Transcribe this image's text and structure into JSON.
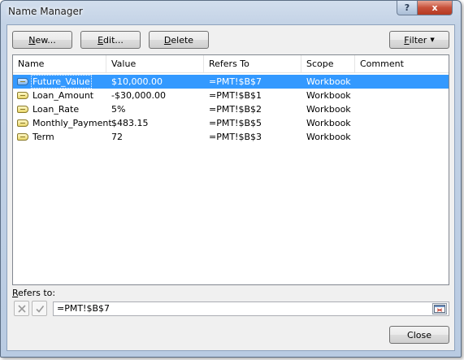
{
  "window": {
    "title": "Name Manager"
  },
  "caption": {
    "help": "?",
    "close": "x"
  },
  "toolbar": {
    "new_label_u": "N",
    "new_label_rest": "ew...",
    "edit_label_u": "E",
    "edit_label_rest": "dit...",
    "delete_label_u": "D",
    "delete_label_rest": "elete",
    "filter_label_u": "F",
    "filter_label_rest": "ilter"
  },
  "table": {
    "columns": [
      "Name",
      "Value",
      "Refers To",
      "Scope",
      "Comment"
    ],
    "rows": [
      {
        "name": "Future_Value",
        "value": "$10,000.00",
        "refers_to": "=PMT!$B$7",
        "scope": "Workbook",
        "comment": "",
        "selected": true
      },
      {
        "name": "Loan_Amount",
        "value": "-$30,000.00",
        "refers_to": "=PMT!$B$1",
        "scope": "Workbook",
        "comment": ""
      },
      {
        "name": "Loan_Rate",
        "value": "5%",
        "refers_to": "=PMT!$B$2",
        "scope": "Workbook",
        "comment": ""
      },
      {
        "name": "Monthly_Payment",
        "value": "$483.15",
        "refers_to": "=PMT!$B$5",
        "scope": "Workbook",
        "comment": ""
      },
      {
        "name": "Term",
        "value": "72",
        "refers_to": "=PMT!$B$3",
        "scope": "Workbook",
        "comment": ""
      }
    ]
  },
  "refers_to": {
    "label_u": "R",
    "label_rest": "efers to:",
    "value": "=PMT!$B$7"
  },
  "footer": {
    "close_label": "Close"
  }
}
